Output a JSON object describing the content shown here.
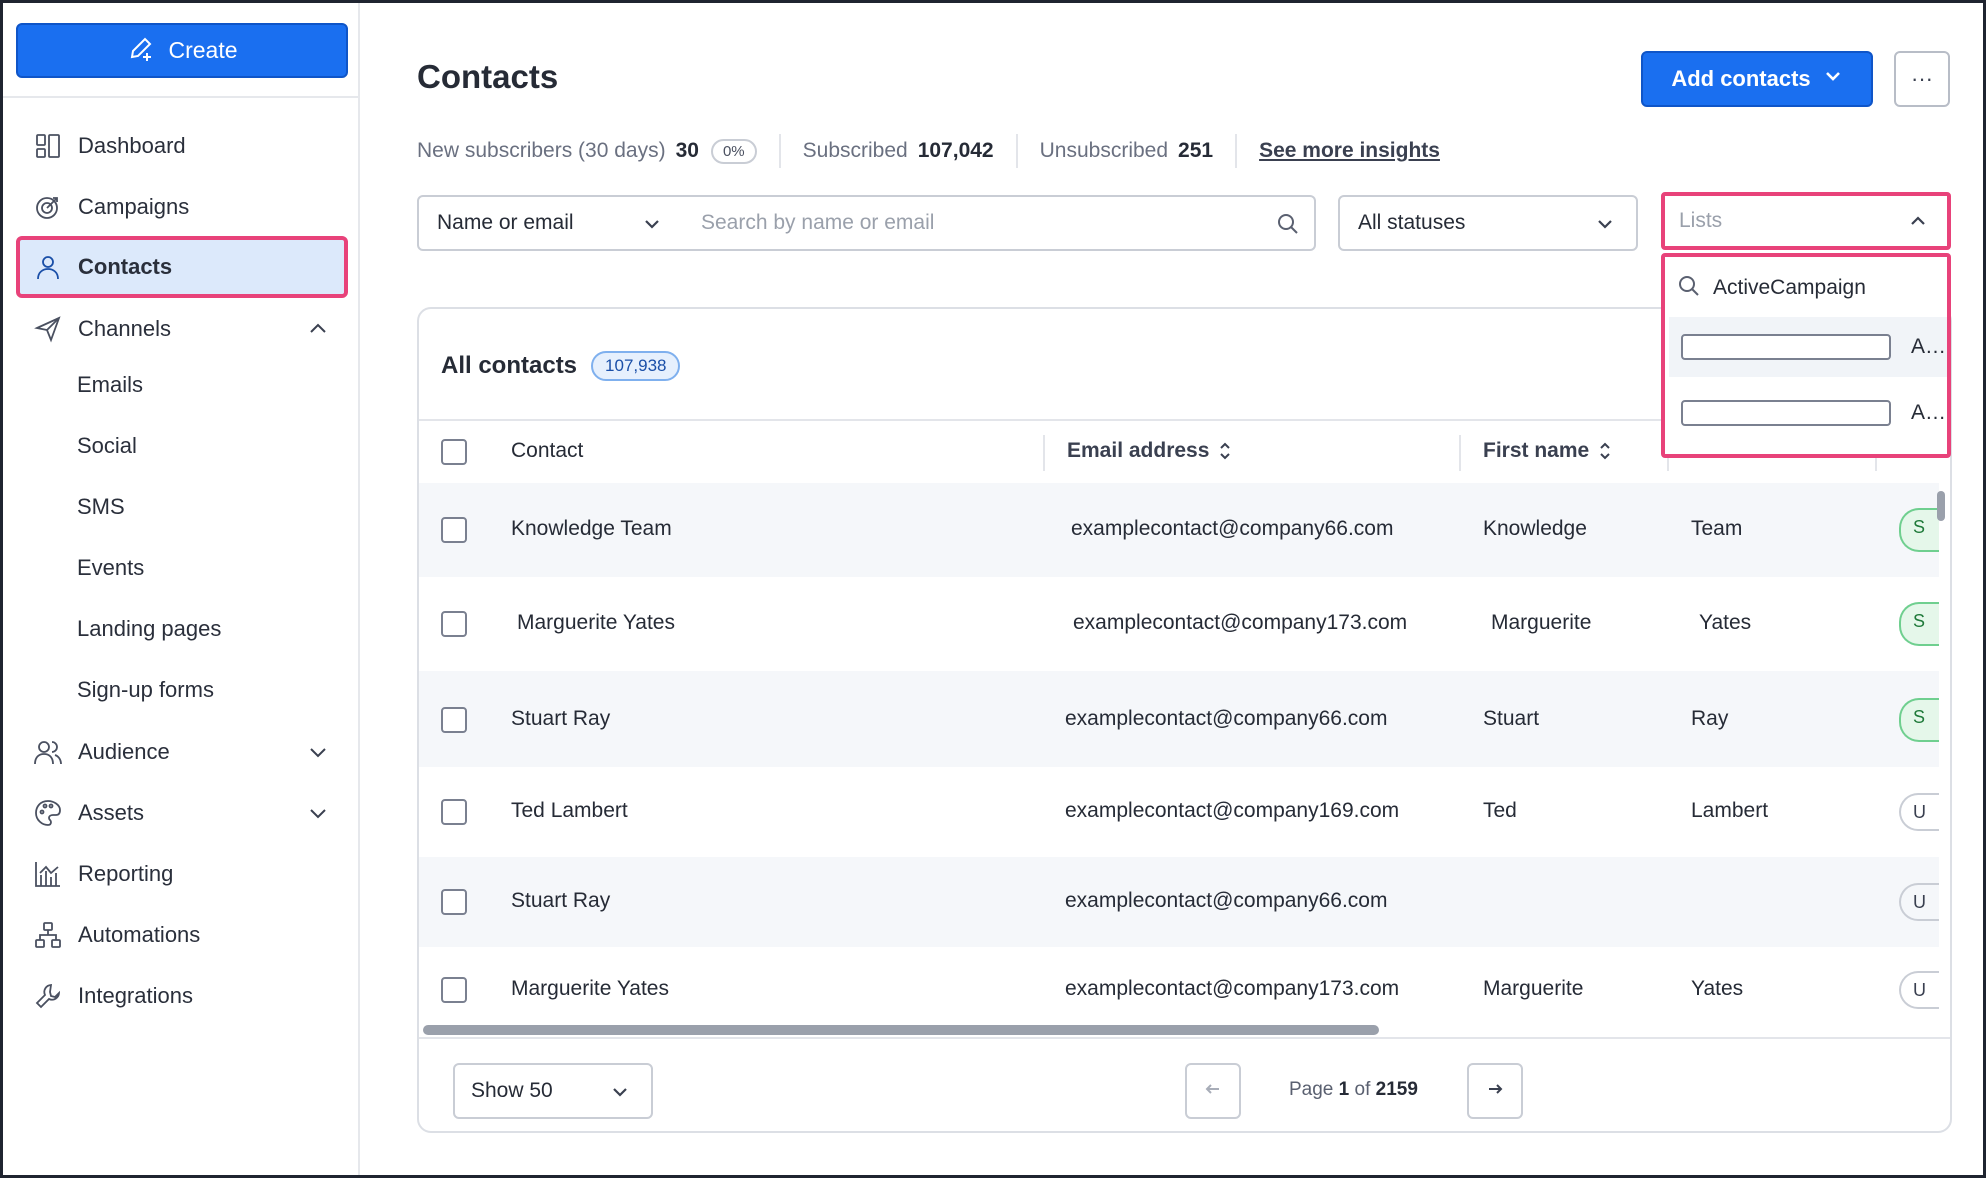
{
  "sidebar": {
    "create_label": "Create",
    "nav": {
      "dashboard": "Dashboard",
      "campaigns": "Campaigns",
      "contacts": "Contacts",
      "channels": "Channels",
      "audience": "Audience",
      "assets": "Assets",
      "reporting": "Reporting",
      "automations": "Automations",
      "integrations": "Integrations"
    },
    "channels_sub": [
      "Emails",
      "Social",
      "SMS",
      "Events",
      "Landing pages",
      "Sign-up forms"
    ]
  },
  "header": {
    "title": "Contacts",
    "add_contacts_label": "Add contacts",
    "more_label": "···"
  },
  "stats": {
    "new_label": "New subscribers (30 days)",
    "new_value": "30",
    "new_pct": "0%",
    "subscribed_label": "Subscribed",
    "subscribed_value": "107,042",
    "unsubscribed_label": "Unsubscribed",
    "unsubscribed_value": "251",
    "insights_link": "See more insights"
  },
  "filters": {
    "field_select": "Name or email",
    "search_placeholder": "Search by name or email",
    "status_select": "All statuses",
    "lists_placeholder": "Lists",
    "lists_search_value": "ActiveCampaign",
    "lists_options": [
      "ActiveCampaign ...",
      "ActiveCampaign ..."
    ]
  },
  "table": {
    "title": "All contacts",
    "count": "107,938",
    "columns": {
      "contact": "Contact",
      "email": "Email address",
      "first_name": "First name"
    },
    "rows": [
      {
        "contact": "Knowledge Team",
        "email": "examplecontact@company66.com",
        "first": "Knowledge",
        "last": "Team",
        "status": "S"
      },
      {
        "contact": "Marguerite Yates",
        "email": "examplecontact@company173.com",
        "first": "Marguerite",
        "last": "Yates",
        "status": "S"
      },
      {
        "contact": "Stuart Ray",
        "email": "examplecontact@company66.com",
        "first": "Stuart",
        "last": "Ray",
        "status": "S"
      },
      {
        "contact": "Ted Lambert",
        "email": "examplecontact@company169.com",
        "first": "Ted",
        "last": "Lambert",
        "status": "U"
      },
      {
        "contact": "Stuart Ray",
        "email": "examplecontact@company66.com",
        "first": "",
        "last": "",
        "status": "U"
      },
      {
        "contact": "Marguerite Yates",
        "email": "examplecontact@company173.com",
        "first": "Marguerite",
        "last": "Yates",
        "status": "U"
      }
    ]
  },
  "pagination": {
    "show_label": "Show 50",
    "page_label": "Page",
    "page_current": "1",
    "page_of": "of",
    "page_total": "2159"
  },
  "colors": {
    "primary": "#1a6ff0",
    "highlight": "#e8427a",
    "active_nav_bg": "#dce9fb"
  }
}
